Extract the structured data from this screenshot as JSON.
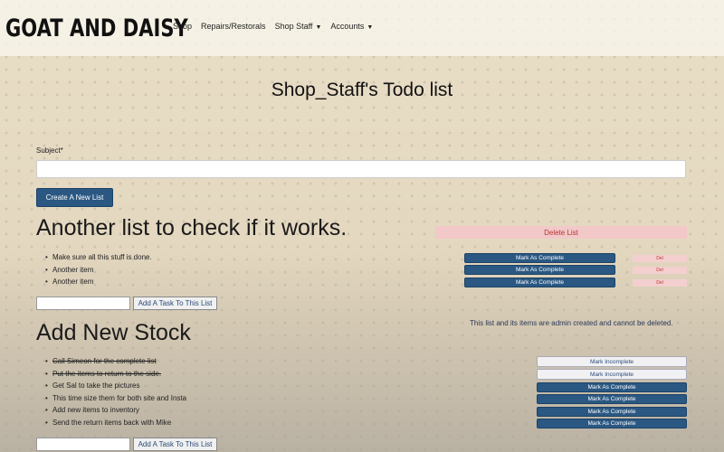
{
  "brand": "GOAT AND DAISY",
  "nav": {
    "shop": "Shop",
    "repairs": "Repairs/Restorals",
    "shop_staff": "Shop Staff",
    "accounts": "Accounts"
  },
  "page_title": "Shop_Staff's Todo list",
  "form": {
    "subject_label": "Subject*",
    "subject_value": "",
    "create_button": "Create A New List"
  },
  "lists": [
    {
      "title": "Another list to check if it works.",
      "delete_label": "Delete List",
      "tasks": [
        {
          "text": "Make sure all this stuff is done.",
          "done": false,
          "action": "Mark As Complete",
          "del": "Del"
        },
        {
          "text": "Another item",
          "done": false,
          "action": "Mark As Complete",
          "del": "Del"
        },
        {
          "text": "Another item",
          "done": false,
          "action": "Mark As Complete",
          "del": "Del"
        }
      ],
      "add_task_button": "Add A Task To This List"
    },
    {
      "title": "Add New Stock",
      "admin_note": "This list and its items are admin created and cannot be deleted.",
      "tasks": [
        {
          "text": "Call Simeon for the complete list",
          "done": true,
          "action": "Mark Incomplete"
        },
        {
          "text": "Put the items to return to the side.",
          "done": true,
          "action": "Mark Incomplete"
        },
        {
          "text": "Get Sal to take the pictures",
          "done": false,
          "action": "Mark As Complete"
        },
        {
          "text": "This time size them for both site and Insta",
          "done": false,
          "action": "Mark As Complete"
        },
        {
          "text": "Add new items to inventory",
          "done": false,
          "action": "Mark As Complete"
        },
        {
          "text": "Send the return items back with Mike",
          "done": false,
          "action": "Mark As Complete"
        }
      ],
      "add_task_button": "Add A Task To This List"
    }
  ],
  "colors": {
    "primary_button": "#2a5883",
    "danger_light": "#f2c8c8"
  }
}
